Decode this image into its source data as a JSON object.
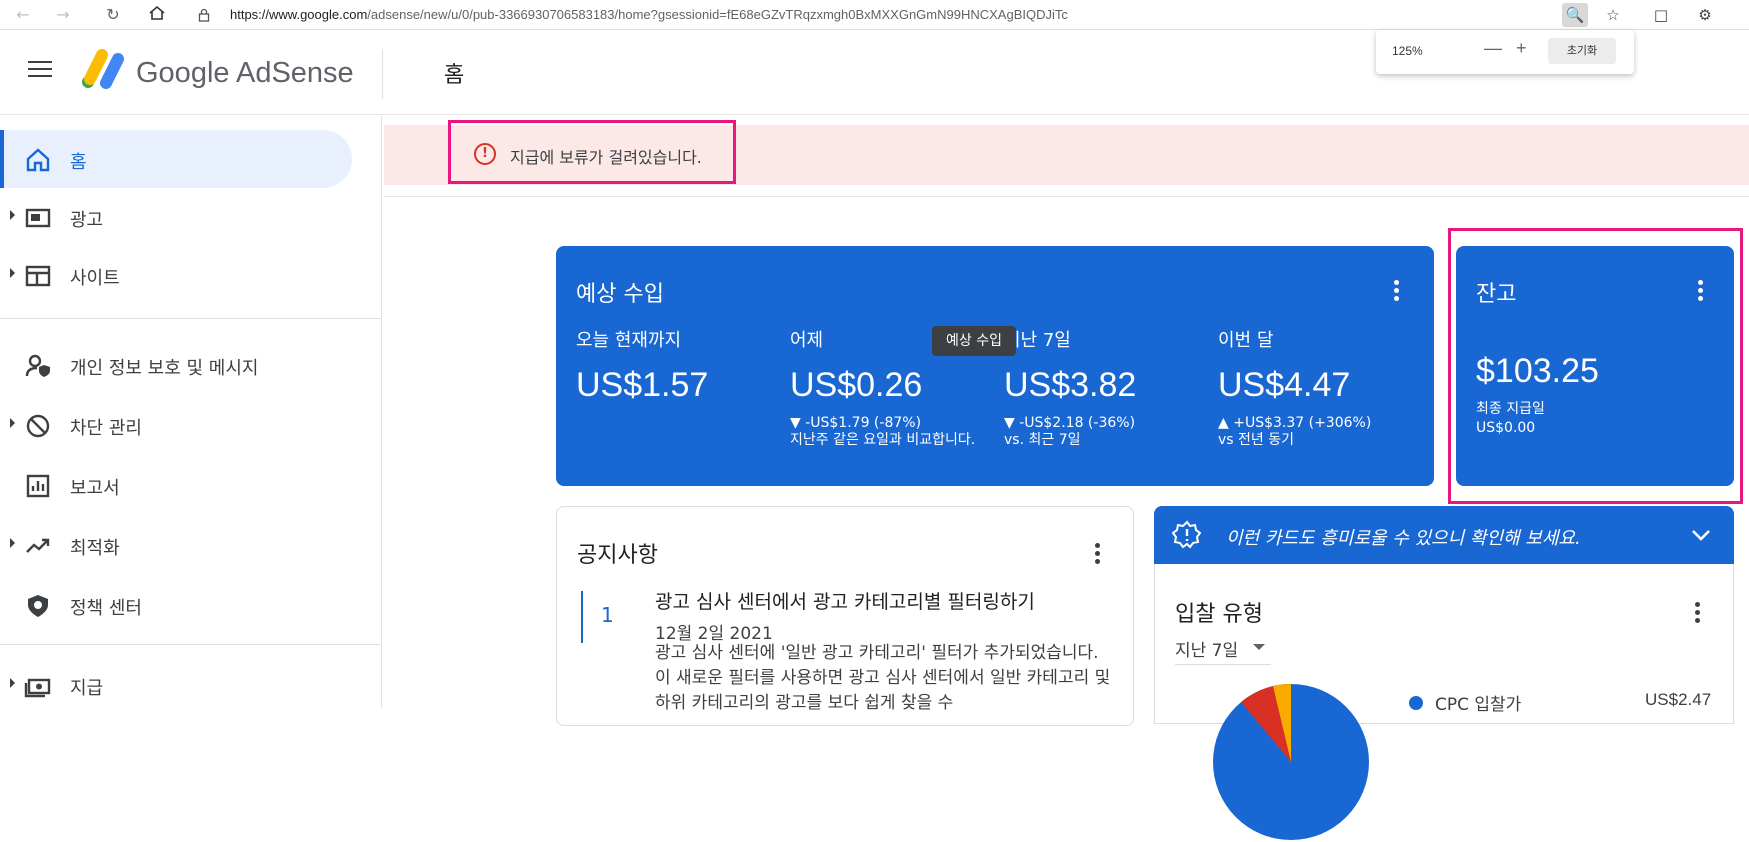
{
  "browser": {
    "url_host": "https://www.google.com",
    "url_path": "/adsense/new/u/0/pub-3366930706583183/home?gsessionid=fE68eGZvTRqzxmgh0BxMXXGnGmN99HNCXAgBIQDJiTc",
    "zoom": {
      "value": "125%",
      "minus": "—",
      "plus": "+",
      "reset": "초기화"
    }
  },
  "header": {
    "brand": "Google AdSense",
    "page_title": "홈"
  },
  "sidebar": {
    "items": [
      {
        "label": "홈",
        "icon": "home-icon"
      },
      {
        "label": "광고",
        "icon": "ads-icon"
      },
      {
        "label": "사이트",
        "icon": "sites-icon"
      },
      {
        "label": "개인 정보 보호 및 메시지",
        "icon": "privacy-icon"
      },
      {
        "label": "차단 관리",
        "icon": "block-icon"
      },
      {
        "label": "보고서",
        "icon": "reports-icon"
      },
      {
        "label": "최적화",
        "icon": "optimization-icon"
      },
      {
        "label": "정책 센터",
        "icon": "policy-icon"
      },
      {
        "label": "지급",
        "icon": "payments-icon"
      }
    ]
  },
  "alert": {
    "text": "지급에 보류가 걸려있습니다."
  },
  "earnings": {
    "title": "예상 수입",
    "tooltip": "예상 수입",
    "metrics": [
      {
        "label": "오늘 현재까지",
        "value": "US$1.57",
        "delta": "",
        "note": ""
      },
      {
        "label": "어제",
        "value": "US$0.26",
        "delta": "▼ -US$1.79 (-87%)",
        "note": "지난주 같은 요일과 비교합니다."
      },
      {
        "label": "지난 7일",
        "value": "US$3.82",
        "delta": "▼ -US$2.18 (-36%)",
        "note": "vs. 최근 7일"
      },
      {
        "label": "이번 달",
        "value": "US$4.47",
        "delta": "▲ +US$3.37 (+306%)",
        "note": "vs 전년 동기"
      }
    ]
  },
  "balance": {
    "title": "잔고",
    "value": "$103.25",
    "last_payment_label": "최종 지급일",
    "last_payment_value": "US$0.00"
  },
  "notices": {
    "title": "공지사항",
    "item": {
      "number": "1",
      "headline": "광고 심사 센터에서 광고 카테고리별 필터링하기",
      "date": "12월 2일 2021",
      "body": "광고 심사 센터에 '일반 광고 카테고리' 필터가 추가되었습니다. 이 새로운 필터를 사용하면 광고 심사 센터에서 일반 카테고리 및 하위 카테고리의 광고를 보다 쉽게 찾을 수"
    }
  },
  "suggestion": {
    "text": "이런 카드도 흥미로울 수 있으니 확인해 보세요."
  },
  "bid_types": {
    "title": "입찰 유형",
    "range": "지난 7일",
    "legend": [
      {
        "label": "CPC 입찰가",
        "value": "US$2.47",
        "color": "#1967d2"
      }
    ]
  },
  "colors": {
    "accent": "#1967d2",
    "alert_bg": "#fce8e6",
    "highlight": "#e8177f"
  }
}
